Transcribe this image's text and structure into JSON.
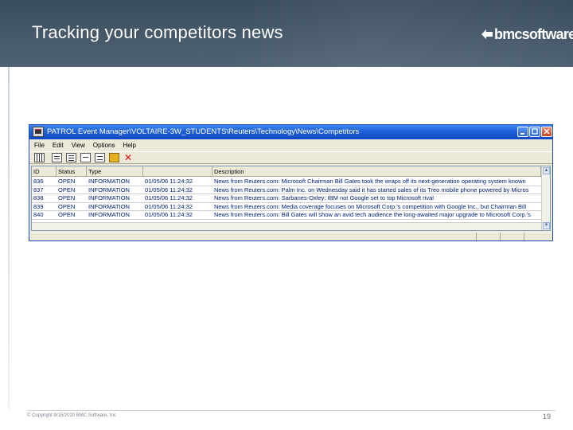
{
  "slide": {
    "title": "Tracking your competitors news",
    "logo_text": "bmcsoftware",
    "copyright": "© Copyright 9/15/2020 BMC Software, Inc",
    "page_number": "19"
  },
  "window": {
    "title": "PATROL Event Manager\\VOLTAIRE-3W_STUDENTS\\Reuters\\Technology\\News\\Competitors",
    "menu": [
      "File",
      "Edit",
      "View",
      "Options",
      "Help"
    ],
    "columns": [
      "ID",
      "Status",
      "Type",
      "",
      "Description"
    ],
    "rows": [
      {
        "id": "836",
        "status": "OPEN",
        "type": "INFORMATION",
        "date": "01/05/06 11:24:32",
        "desc": "News from Reuters.com: Microsoft Chairman Bill Gates took the wraps off its next-generation operating system known"
      },
      {
        "id": "837",
        "status": "OPEN",
        "type": "INFORMATION",
        "date": "01/05/06 11:24:32",
        "desc": "News from Reuters.com: Palm Inc. on Wednesday said it has started sales of its Treo mobile phone powered by Micros"
      },
      {
        "id": "838",
        "status": "OPEN",
        "type": "INFORMATION",
        "date": "01/05/06 11:24:32",
        "desc": "News from Reuters.com: Sarbanes-Oxley: IBM not Google set to top Microsoft rival"
      },
      {
        "id": "839",
        "status": "OPEN",
        "type": "INFORMATION",
        "date": "01/05/06 11:24:32",
        "desc": "News from Reuters.com: Media coverage focuses on Microsoft Corp.'s competition with Google Inc., but Chairman Bill"
      },
      {
        "id": "840",
        "status": "OPEN",
        "type": "INFORMATION",
        "date": "01/05/06 11:24:32",
        "desc": "News from Reuters.com: Bill Gates will show an avid tech audience the long-awaited major upgrade to Microsoft Corp.'s"
      }
    ]
  },
  "colors": {
    "header_bg": "#46596a",
    "titlebar": "#1f5fd7",
    "window_bg": "#ece9d8",
    "grid_text": "#00207a"
  },
  "icons": [
    "app-icon",
    "grid-icon",
    "document-icon",
    "document-icon",
    "properties-icon",
    "filter-icon",
    "wrench-icon",
    "close-icon"
  ]
}
